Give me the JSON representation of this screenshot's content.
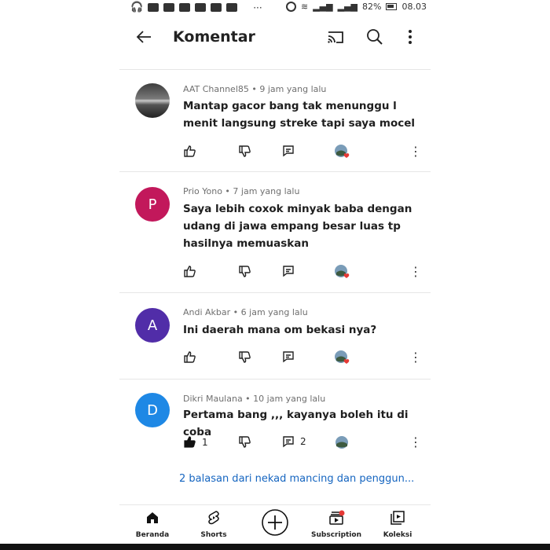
{
  "status_bar": {
    "battery": "82%",
    "time": "08.03"
  },
  "header": {
    "title": "Komentar"
  },
  "comments": [
    {
      "author": "AAT Channel85",
      "time": "9 jam yang lalu",
      "text": "Mantap gacor bang tak menunggu l menit langsung streke tapi saya mocel",
      "likes": "",
      "replies": ""
    },
    {
      "author": "Prio Yono",
      "time": "7 jam yang lalu",
      "initial": "P",
      "text": "Saya lebih coxok minyak baba dengan udang  di jawa empang besar luas tp hasilnya memuaskan",
      "likes": "",
      "replies": ""
    },
    {
      "author": "Andi Akbar",
      "time": "6 jam yang lalu",
      "initial": "A",
      "text": "Ini daerah mana om bekasi nya?",
      "likes": "",
      "replies": ""
    },
    {
      "author": "Dikri Maulana",
      "time": "10 jam yang lalu",
      "initial": "D",
      "text": "Pertama bang ,,, kayanya boleh itu di coba",
      "likes": "1",
      "replies": "2"
    }
  ],
  "replies_link": "2 balasan dari nekad mancing dan penggun...",
  "nav": [
    {
      "label": "Beranda",
      "icon": "home-icon"
    },
    {
      "label": "Shorts",
      "icon": "shorts-icon"
    },
    {
      "label": "",
      "icon": "create-icon"
    },
    {
      "label": "Subscription",
      "icon": "subscriptions-icon"
    },
    {
      "label": "Koleksi",
      "icon": "library-icon"
    }
  ],
  "colors": {
    "avatar_p": "#c2185b",
    "avatar_a": "#512da8",
    "avatar_d": "#1e88e5",
    "link": "#1565c0"
  }
}
